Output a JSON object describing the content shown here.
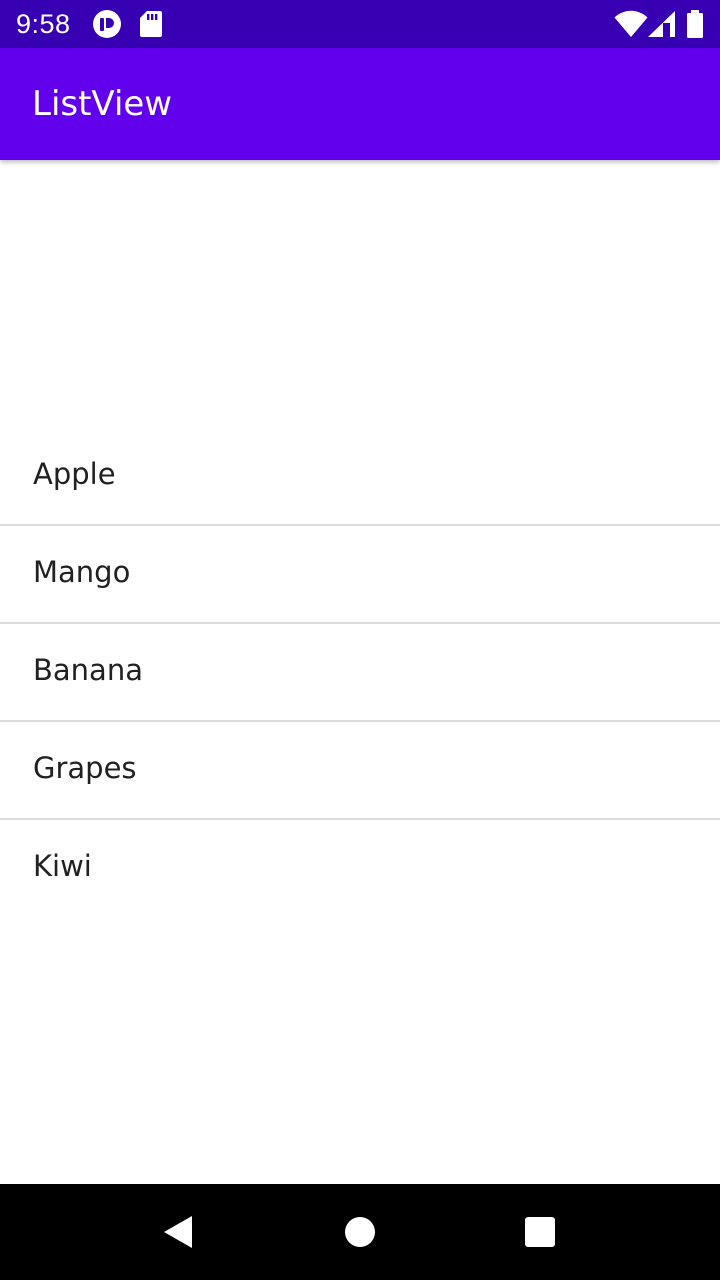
{
  "status_bar": {
    "time": "9:58",
    "icons": [
      "notification-app-icon",
      "sd-card-icon",
      "wifi-icon",
      "cell-signal-icon",
      "battery-icon"
    ]
  },
  "app_bar": {
    "title": "ListView",
    "color": "#6200ee"
  },
  "status_bar_color": "#3700b3",
  "list": {
    "items": [
      {
        "label": "Apple"
      },
      {
        "label": "Mango"
      },
      {
        "label": "Banana"
      },
      {
        "label": "Grapes"
      },
      {
        "label": "Kiwi"
      }
    ]
  },
  "nav_bar": {
    "buttons": [
      "back-icon",
      "home-icon",
      "recents-icon"
    ]
  }
}
